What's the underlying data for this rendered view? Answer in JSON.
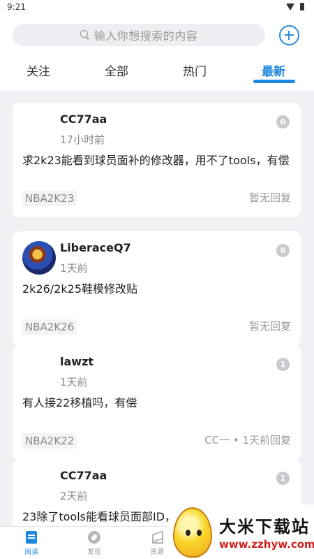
{
  "status_bar": {
    "time": "9:21",
    "wifi_icon": "wifi-icon",
    "battery_icon": "battery-icon"
  },
  "search": {
    "placeholder": "输入你想搜索的内容",
    "icon": "search-icon"
  },
  "add_button": {
    "icon": "plus-circle-icon",
    "color": "#2a8ce5"
  },
  "tabs": [
    {
      "label": "关注",
      "active": false
    },
    {
      "label": "全部",
      "active": false
    },
    {
      "label": "热门",
      "active": false
    },
    {
      "label": "最新",
      "active": true
    }
  ],
  "accent_color": "#1e87e0",
  "posts": [
    {
      "username": "CC77aa",
      "time": "17小时前",
      "reply_count": "0",
      "content": "求2k23能看到球员面补的修改器，用不了tools，有偿",
      "tag": "NBA2K23",
      "reply_status": "暂无回复",
      "has_avatar": false
    },
    {
      "username": "LiberaceQ7",
      "time": "1天前",
      "reply_count": "0",
      "content": "2k26/2k25鞋模修改贴",
      "tag": "NBA2K26",
      "reply_status": "暂无回复",
      "has_avatar": true
    },
    {
      "username": "lawzt",
      "time": "1天前",
      "reply_count": "1",
      "content": "有人接22移植吗，有偿",
      "tag": "NBA2K22",
      "reply_status": "CC一 • 1天前回复",
      "has_avatar": false
    },
    {
      "username": "CC77aa",
      "time": "2天前",
      "reply_count": "1",
      "content": "23除了tools能看球员面部ID，",
      "tag": "",
      "reply_status": "",
      "has_avatar": false
    }
  ],
  "bottom_nav": [
    {
      "label": "阅读",
      "icon": "book-icon",
      "active": true
    },
    {
      "label": "发现",
      "icon": "compass-icon",
      "active": false
    },
    {
      "label": "资源",
      "icon": "layers-icon",
      "active": false
    }
  ],
  "watermark": {
    "title": "大米下载站",
    "url": "www.zzhyw.com"
  }
}
